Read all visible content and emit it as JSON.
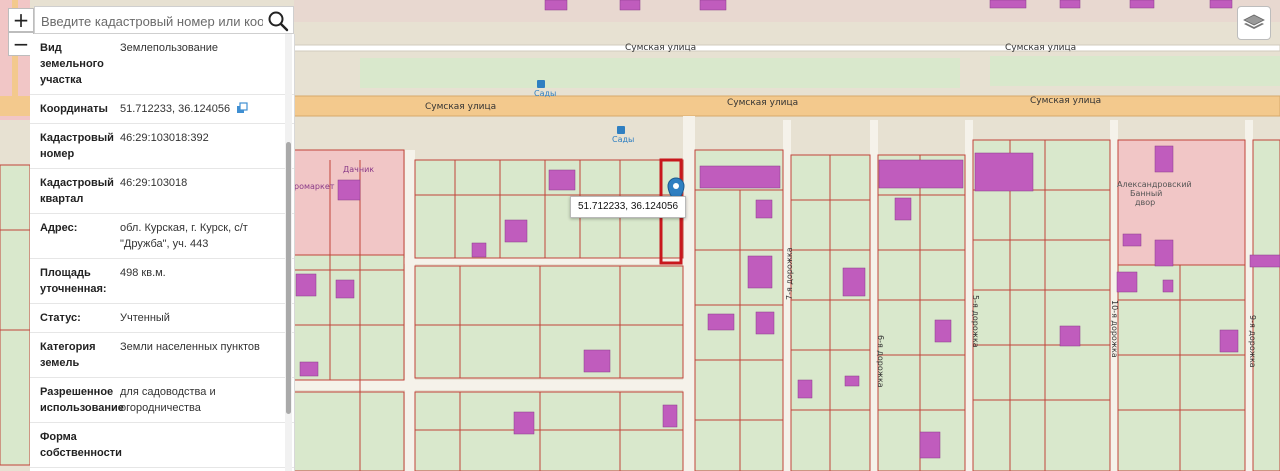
{
  "map": {
    "streets": {
      "sumskaya_top": "Сумская улица",
      "sumskaya_top_right": "Сумская улица",
      "sumskaya_main_1": "Сумская улица",
      "sumskaya_main_2": "Сумская улица",
      "sumskaya_main_3": "Сумская улица",
      "lane_7": "7-я дорожка",
      "lane_6": "6-я дорожка",
      "lane_5": "5-я дорожка",
      "lane_10": "10-я дорожка",
      "lane_9": "9-я дорожка"
    },
    "poi": {
      "bus_stop_1": "Сады",
      "bus_stop_2": "Сады",
      "shop_1": "Дачник",
      "shop_2": "ромаркет",
      "banya_1": "Александровский",
      "banya_2": "Банный",
      "banya_3": "двор"
    },
    "colors": {
      "background": "#e7e1d2",
      "garden": "#d9e8cc",
      "road": "#f3c98d",
      "building": "#c05cbd",
      "parcel_border": "#c1443a",
      "selected_parcel": "#c8171d",
      "marker": "#2f7fc1"
    }
  },
  "search": {
    "placeholder": "Введите кадастровый номер или координаты"
  },
  "zoom": {
    "in_label": "+",
    "out_label": "−"
  },
  "popup": {
    "coordinates": "51.712233, 36.124056"
  },
  "info_panel": {
    "rows": [
      {
        "key": "Вид земельного участка",
        "value": "Землепользование"
      },
      {
        "key": "Координаты",
        "value": "51.712233, 36.124056"
      },
      {
        "key": "Кадастровый номер",
        "value": "46:29:103018:392"
      },
      {
        "key": "Кадастровый квартал",
        "value": "46:29:103018"
      },
      {
        "key": "Адрес:",
        "value": "обл. Курская, г. Курск, с/т \"Дружба\", уч. 443"
      },
      {
        "key": "Площадь уточненная:",
        "value": "498 кв.м."
      },
      {
        "key": "Статус:",
        "value": "Учтенный"
      },
      {
        "key": "Категория земель",
        "value": "Земли населенных пунктов"
      },
      {
        "key": "Разрешенное использование",
        "value": "для садоводства и огородничества"
      },
      {
        "key": "Форма собственности",
        "value": ""
      }
    ]
  }
}
